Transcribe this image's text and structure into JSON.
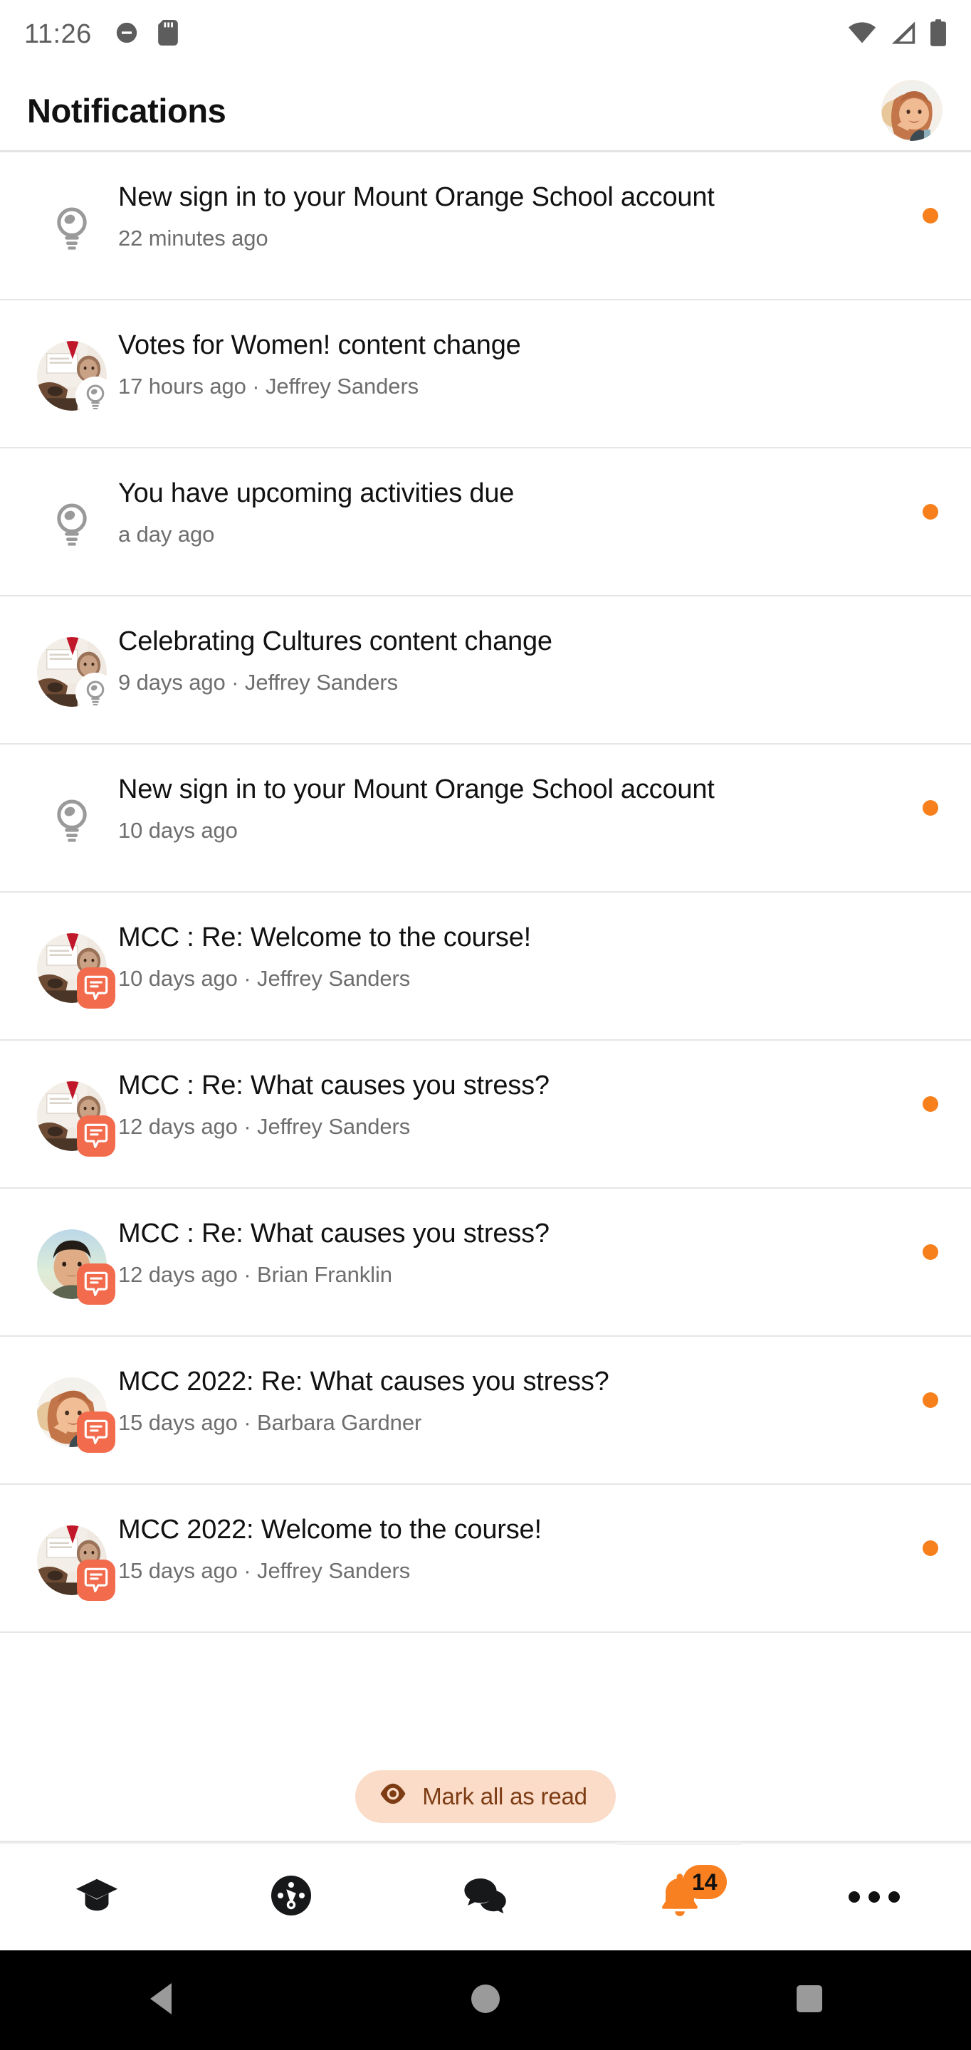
{
  "status_bar": {
    "time": "11:26",
    "left_icons": [
      "do-not-disturb-icon",
      "sd-card-icon"
    ],
    "right_icons": [
      "wifi-icon",
      "cellular-signal-icon",
      "battery-icon"
    ]
  },
  "app_bar": {
    "title": "Notifications",
    "avatar": "user-avatar"
  },
  "colors": {
    "accent_orange": "#f98020",
    "unread_dot": "#f7801c",
    "forum_badge": "#f26b4d",
    "markall_bg": "#fadcc8",
    "markall_text": "#7d3c14",
    "divider": "#e6e6e6",
    "subtitle_text": "#6e6e6e",
    "title_text": "#111111"
  },
  "notifications": [
    {
      "title": "New sign in to your Mount Orange School account",
      "subtitle": "22 minutes ago",
      "time": "22 minutes ago",
      "author": "",
      "icon": "lightbulb-icon",
      "icon_type": "bulb",
      "avatar": "",
      "unread": true
    },
    {
      "title": "Votes for Women! content change",
      "subtitle": "17 hours ago · Jeffrey Sanders",
      "time": "17 hours ago",
      "author": "Jeffrey Sanders",
      "icon": "lightbulb-icon",
      "icon_type": "avatar-bulb",
      "avatar": "jeffrey-sanders-avatar",
      "unread": false
    },
    {
      "title": "You have upcoming activities due",
      "subtitle": "a day ago",
      "time": "a day ago",
      "author": "",
      "icon": "lightbulb-icon",
      "icon_type": "bulb",
      "avatar": "",
      "unread": true
    },
    {
      "title": "Celebrating Cultures content change",
      "subtitle": "9 days ago · Jeffrey Sanders",
      "time": "9 days ago",
      "author": "Jeffrey Sanders",
      "icon": "lightbulb-icon",
      "icon_type": "avatar-bulb",
      "avatar": "jeffrey-sanders-avatar",
      "unread": false
    },
    {
      "title": "New sign in to your Mount Orange School account",
      "subtitle": "10 days ago",
      "time": "10 days ago",
      "author": "",
      "icon": "lightbulb-icon",
      "icon_type": "bulb",
      "avatar": "",
      "unread": true
    },
    {
      "title": "MCC : Re: Welcome to the course!",
      "subtitle": "10 days ago · Jeffrey Sanders",
      "time": "10 days ago",
      "author": "Jeffrey Sanders",
      "icon": "forum-icon",
      "icon_type": "avatar-forum",
      "avatar": "jeffrey-sanders-avatar",
      "unread": false
    },
    {
      "title": "MCC : Re: What causes you stress?",
      "subtitle": "12 days ago · Jeffrey Sanders",
      "time": "12 days ago",
      "author": "Jeffrey Sanders",
      "icon": "forum-icon",
      "icon_type": "avatar-forum",
      "avatar": "jeffrey-sanders-avatar",
      "unread": true
    },
    {
      "title": "MCC : Re: What causes you stress?",
      "subtitle": "12 days ago · Brian Franklin",
      "time": "12 days ago",
      "author": "Brian Franklin",
      "icon": "forum-icon",
      "icon_type": "avatar-forum",
      "avatar": "brian-franklin-avatar",
      "unread": true
    },
    {
      "title": "MCC 2022: Re: What causes you stress?",
      "subtitle": "15 days ago · Barbara Gardner",
      "time": "15 days ago",
      "author": "Barbara Gardner",
      "icon": "forum-icon",
      "icon_type": "avatar-forum",
      "avatar": "barbara-gardner-avatar",
      "unread": true
    },
    {
      "title": "MCC 2022: Welcome to the course!",
      "subtitle": "15 days ago · Jeffrey Sanders",
      "time": "15 days ago",
      "author": "Jeffrey Sanders",
      "icon": "forum-icon",
      "icon_type": "avatar-forum",
      "avatar": "jeffrey-sanders-avatar",
      "unread": true
    }
  ],
  "mark_all_as_read": {
    "label": "Mark all as read",
    "icon": "eye-icon"
  },
  "tab_bar": {
    "items": [
      {
        "name": "courses",
        "icon": "graduation-cap-icon",
        "active": false,
        "badge": ""
      },
      {
        "name": "dashboard",
        "icon": "dashboard-gauge-icon",
        "active": false,
        "badge": ""
      },
      {
        "name": "messages",
        "icon": "chat-bubbles-icon",
        "active": false,
        "badge": ""
      },
      {
        "name": "notifications",
        "icon": "bell-icon",
        "active": true,
        "badge": "14"
      },
      {
        "name": "more",
        "icon": "more-horizontal-icon",
        "active": false,
        "badge": ""
      }
    ]
  },
  "android_nav": {
    "back": "back-triangle-icon",
    "home": "home-circle-icon",
    "recents": "recents-square-icon"
  }
}
